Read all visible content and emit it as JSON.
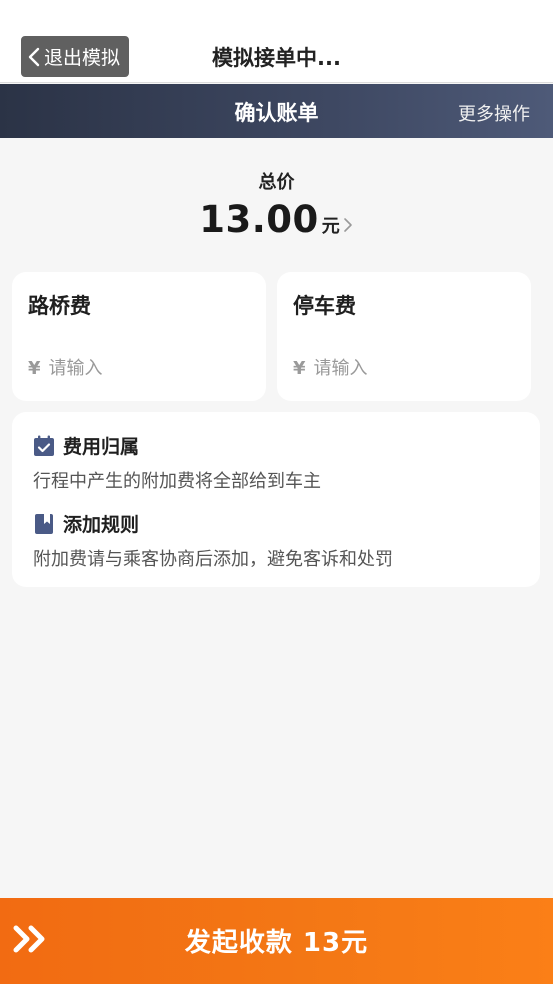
{
  "sim_bar": {
    "exit_label": "退出模拟",
    "title": "模拟接单中..."
  },
  "header": {
    "title": "确认账单",
    "more_label": "更多操作"
  },
  "total": {
    "label": "总价",
    "amount": "13.00",
    "unit": "元"
  },
  "fees": [
    {
      "title": "路桥费",
      "currency": "¥",
      "placeholder": "请输入",
      "value": ""
    },
    {
      "title": "停车费",
      "currency": "¥",
      "placeholder": "请输入",
      "value": ""
    }
  ],
  "info": {
    "ownership_title": "费用归属",
    "ownership_desc": "行程中产生的附加费将全部给到车主",
    "rules_title": "添加规则",
    "rules_desc": "附加费请与乘客协商后添加，避免客诉和处罚"
  },
  "bottom": {
    "label": "发起收款 13元"
  },
  "colors": {
    "header_bg": "#3e4862",
    "accent_orange": "#f37715",
    "icon_blue": "#4a5a86"
  },
  "icons": [
    "chevron-left-icon",
    "chevron-right-icon",
    "calendar-check-icon",
    "bookmark-book-icon",
    "double-chevron-right-icon"
  ]
}
